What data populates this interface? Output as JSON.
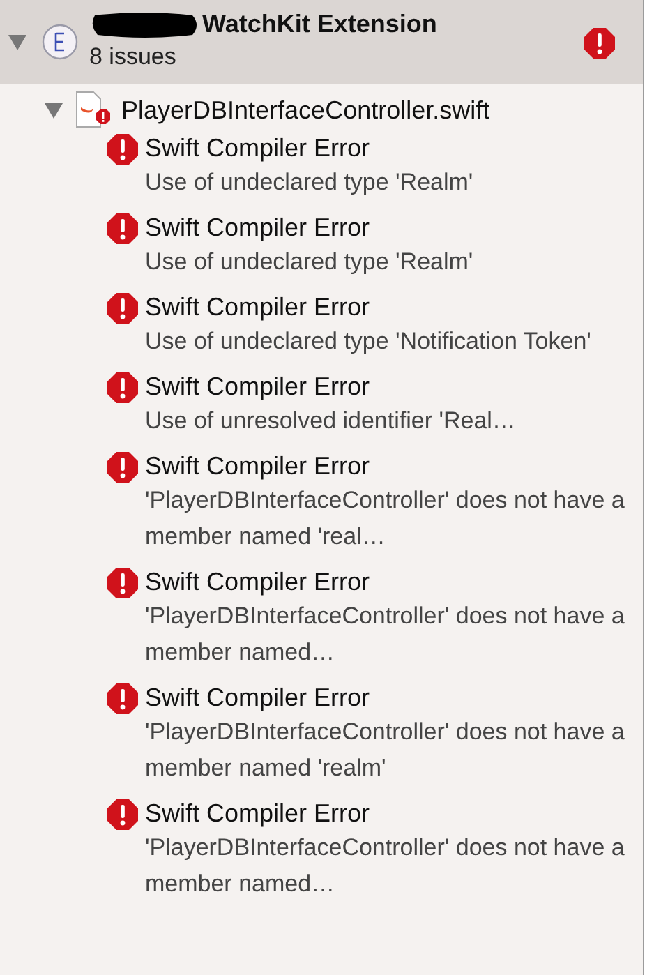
{
  "target": {
    "name": "WatchKit Extension",
    "issue_count": "8 issues",
    "redacted": true,
    "expanded": true
  },
  "file": {
    "name": "PlayerDBInterfaceController.swift",
    "expanded": true
  },
  "issues": [
    {
      "title": "Swift Compiler Error",
      "message": "Use of undeclared type 'Realm'"
    },
    {
      "title": "Swift Compiler Error",
      "message": "Use of undeclared type 'Realm'"
    },
    {
      "title": "Swift Compiler Error",
      "message": "Use of undeclared type 'Notification Token'"
    },
    {
      "title": "Swift Compiler Error",
      "message": "Use of unresolved identifier 'Real…"
    },
    {
      "title": "Swift Compiler Error",
      "message": "'PlayerDBInterfaceController' does not have a member named 'real…"
    },
    {
      "title": "Swift Compiler Error",
      "message": "'PlayerDBInterfaceController' does not have a member named…"
    },
    {
      "title": "Swift Compiler Error",
      "message": "'PlayerDBInterfaceController' does not have a member named 'realm'"
    },
    {
      "title": "Swift Compiler Error",
      "message": "'PlayerDBInterfaceController' does not have a member named…"
    }
  ]
}
